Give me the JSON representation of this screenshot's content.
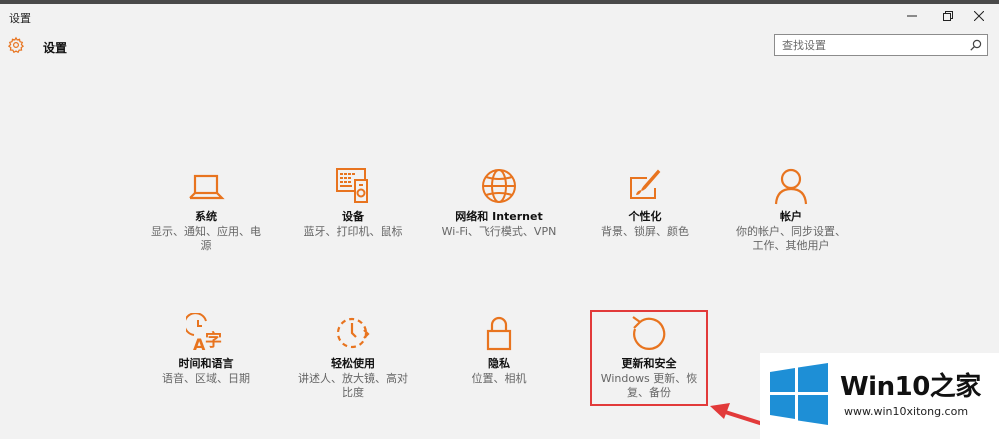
{
  "window": {
    "title": "设置"
  },
  "header": {
    "title": "设置"
  },
  "search": {
    "placeholder": "查找设置"
  },
  "tiles": [
    {
      "id": "system",
      "name": "系统",
      "desc": "显示、通知、应用、电源",
      "icon": "laptop-icon"
    },
    {
      "id": "devices",
      "name": "设备",
      "desc": "蓝牙、打印机、鼠标",
      "icon": "devices-icon"
    },
    {
      "id": "network",
      "name": "网络和 Internet",
      "desc": "Wi-Fi、飞行模式、VPN",
      "icon": "globe-icon"
    },
    {
      "id": "personalization",
      "name": "个性化",
      "desc": "背景、锁屏、颜色",
      "icon": "paint-icon"
    },
    {
      "id": "accounts",
      "name": "帐户",
      "desc": "你的帐户、同步设置、工作、其他用户",
      "icon": "person-icon"
    },
    {
      "id": "time-language",
      "name": "时间和语言",
      "desc": "语音、区域、日期",
      "icon": "time-language-icon"
    },
    {
      "id": "ease-of-access",
      "name": "轻松使用",
      "desc": "讲述人、放大镜、高对比度",
      "icon": "ease-of-access-icon"
    },
    {
      "id": "privacy",
      "name": "隐私",
      "desc": "位置、相机",
      "icon": "lock-icon"
    },
    {
      "id": "update-security",
      "name": "更新和安全",
      "desc": "Windows 更新、恢复、备份",
      "icon": "refresh-icon"
    }
  ],
  "watermark": {
    "title": "Win10之家",
    "url": "www.win10xitong.com"
  },
  "colors": {
    "accent": "#e8741f",
    "background": "#f2f2f2",
    "highlight": "#e23a3a",
    "windows_blue": "#1e8fd6"
  }
}
